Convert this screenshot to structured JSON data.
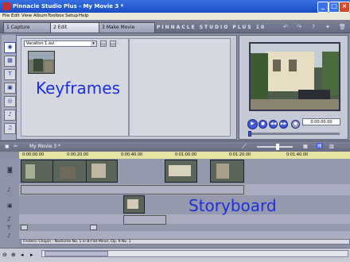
{
  "window": {
    "title": "Pinnacle Studio Plus - My Movie 3 *"
  },
  "menu": [
    "File",
    "Edit",
    "View",
    "Album",
    "Toolbox",
    "Setup",
    "Help"
  ],
  "modes": [
    {
      "label": "1 Capture"
    },
    {
      "label": "2 Edit"
    },
    {
      "label": "3 Make Movie"
    }
  ],
  "brand": "PINNACLE STUDIO PLUS 10",
  "album": {
    "dropdown_value": "Vacation 1.avi"
  },
  "overlay_labels": {
    "keyframes": "Keyframes",
    "storyboard": "Storyboard"
  },
  "player": {
    "timecode": "0:00.00.00"
  },
  "timeline": {
    "project_title": "My Movie 3 *",
    "ruler": [
      "0:00:00.00",
      "0:00:20.00",
      "0:00:40.00",
      "0:01:00.00",
      "0:01:20.00",
      "0:01:40.00"
    ],
    "music_clip": "Frederic Chopin - Nocturne No. 1 in B-Flat Minor, Op. 9 No. 1"
  },
  "colors": {
    "overlay_text": "#1c2fd6",
    "titlebar": "#1a4dc4",
    "ruler": "#e5e4a3"
  }
}
